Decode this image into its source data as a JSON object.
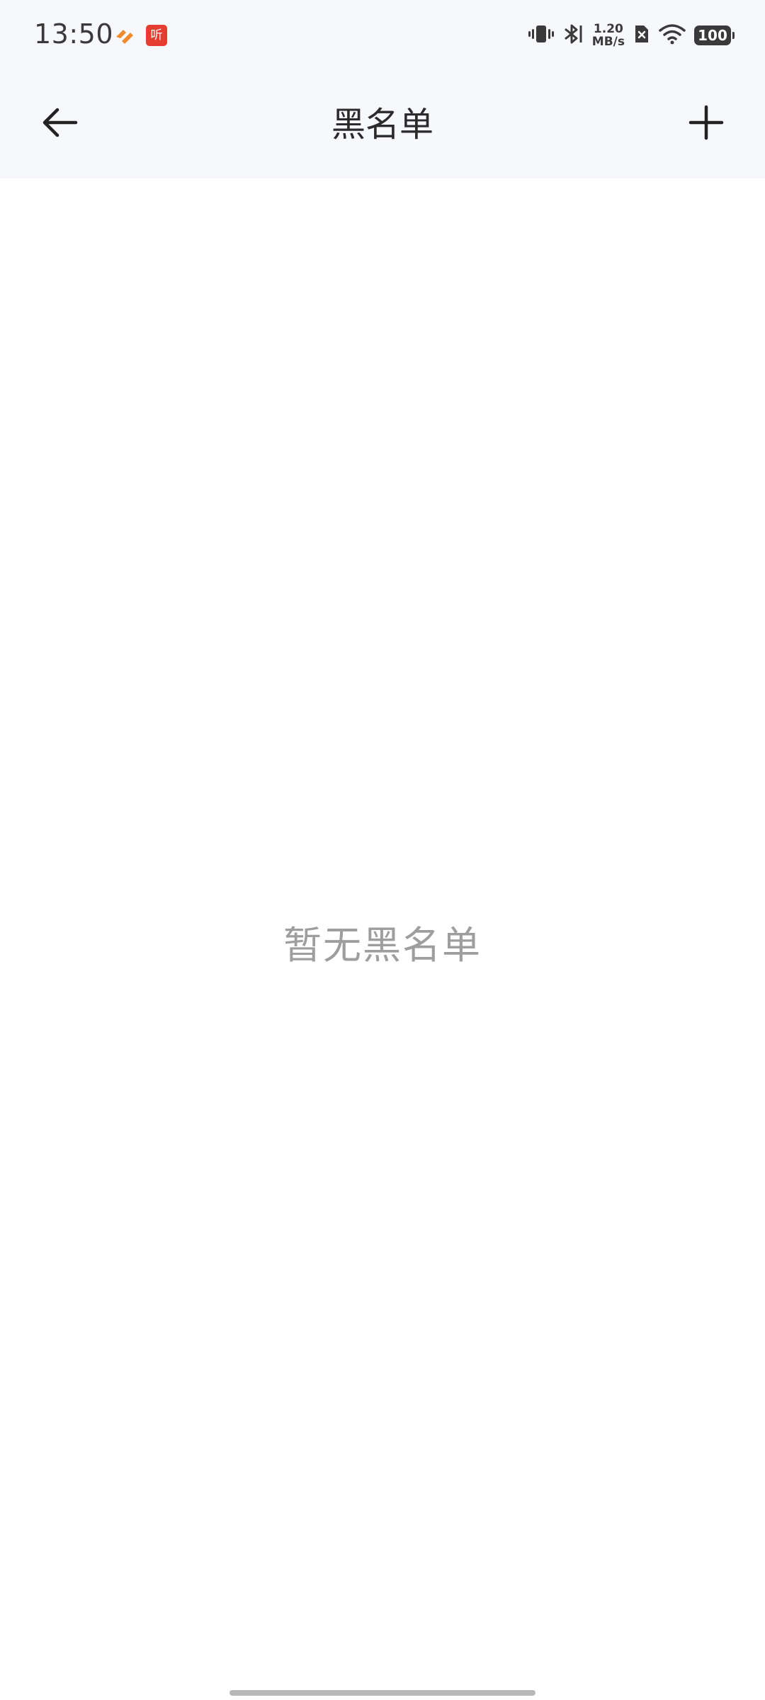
{
  "status_bar": {
    "time": "13:50",
    "notification_app_label": "听",
    "network_speed_value": "1.20",
    "network_speed_unit": "MB/s",
    "battery_level": "100",
    "icons": [
      "vibrate-icon",
      "bluetooth-icon",
      "no-sim-icon",
      "wifi-icon",
      "battery-icon"
    ]
  },
  "app_bar": {
    "title": "黑名单",
    "back_icon": "arrow-left-icon",
    "add_icon": "plus-icon"
  },
  "empty_state": {
    "message": "暂无黑名单"
  },
  "colors": {
    "header_background": "#f7f8fb",
    "empty_text": "#9e9e9e",
    "title_text": "#2b2b2b",
    "notification_red": "#e53d2f",
    "notification_orange": "#f08a2c"
  }
}
